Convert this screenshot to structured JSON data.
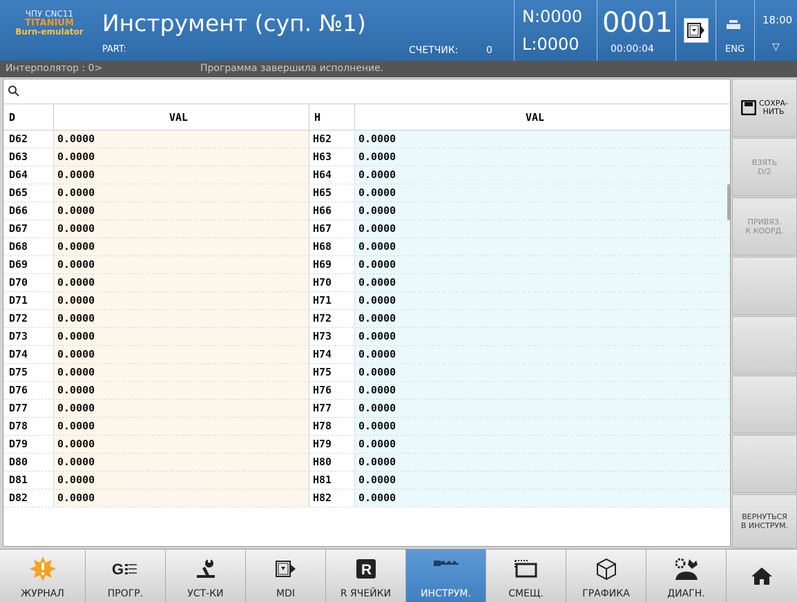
{
  "header": {
    "brand_line1": "ЧПУ CNC11",
    "brand_line2": "TITANIUM",
    "brand_line3": "Burn-emulator",
    "title": "Инструмент (суп. №1)",
    "part_label": "PART:",
    "counter_label": "СЧЕТЧИК:",
    "counter_value": "0",
    "n_value": "N:0000",
    "l_value": "L:0000",
    "program_number": "0001",
    "elapsed_time": "00:00:04",
    "language": "ENG",
    "clock": "18:00"
  },
  "status": {
    "interpolator": "Интерполятор : 0>",
    "message": "Программа завершила исполнение."
  },
  "table": {
    "columns": [
      "D",
      "VAL",
      "H",
      "VAL"
    ],
    "rows": [
      [
        "D62",
        "0.0000",
        "H62",
        "0.0000"
      ],
      [
        "D63",
        "0.0000",
        "H63",
        "0.0000"
      ],
      [
        "D64",
        "0.0000",
        "H64",
        "0.0000"
      ],
      [
        "D65",
        "0.0000",
        "H65",
        "0.0000"
      ],
      [
        "D66",
        "0.0000",
        "H66",
        "0.0000"
      ],
      [
        "D67",
        "0.0000",
        "H67",
        "0.0000"
      ],
      [
        "D68",
        "0.0000",
        "H68",
        "0.0000"
      ],
      [
        "D69",
        "0.0000",
        "H69",
        "0.0000"
      ],
      [
        "D70",
        "0.0000",
        "H70",
        "0.0000"
      ],
      [
        "D71",
        "0.0000",
        "H71",
        "0.0000"
      ],
      [
        "D72",
        "0.0000",
        "H72",
        "0.0000"
      ],
      [
        "D73",
        "0.0000",
        "H73",
        "0.0000"
      ],
      [
        "D74",
        "0.0000",
        "H74",
        "0.0000"
      ],
      [
        "D75",
        "0.0000",
        "H75",
        "0.0000"
      ],
      [
        "D76",
        "0.0000",
        "H76",
        "0.0000"
      ],
      [
        "D77",
        "0.0000",
        "H77",
        "0.0000"
      ],
      [
        "D78",
        "0.0000",
        "H78",
        "0.0000"
      ],
      [
        "D79",
        "0.0000",
        "H79",
        "0.0000"
      ],
      [
        "D80",
        "0.0000",
        "H80",
        "0.0000"
      ],
      [
        "D81",
        "0.0000",
        "H81",
        "0.0000"
      ],
      [
        "D82",
        "0.0000",
        "H82",
        "0.0000"
      ]
    ]
  },
  "side_buttons": {
    "save_line1": "СОХРА-",
    "save_line2": "НИТЬ",
    "take_line1": "ВЗЯТЬ",
    "take_line2": "D/2",
    "bind_line1": "ПРИВЯЗ.",
    "bind_line2": "К КООРД.",
    "back_line1": "ВЕРНУТЬСЯ",
    "back_line2": "В ИНСТРУМ."
  },
  "bottom_nav": {
    "journal": "ЖУРНАЛ",
    "program": "ПРОГР.",
    "settings": "УСТ-КИ",
    "mdi": "MDI",
    "r_cells": "R ЯЧЕЙКИ",
    "tools": "ИНСТРУМ.",
    "offsets": "СМЕЩ.",
    "graphics": "ГРАФИКА",
    "diagnostics": "ДИАГН."
  },
  "colors": {
    "header_blue": "#3a77b8",
    "brand_orange": "#ff9a1a",
    "active_tab": "#4a8ad0",
    "d_val_bg": "#fdf6ea",
    "h_val_bg": "#eaf9fc",
    "journal_icon": "#f5a21c"
  },
  "icons": {
    "search": "search-icon",
    "save": "floppy-disk-icon",
    "home": "home-icon",
    "journal": "warning-burst-icon"
  }
}
